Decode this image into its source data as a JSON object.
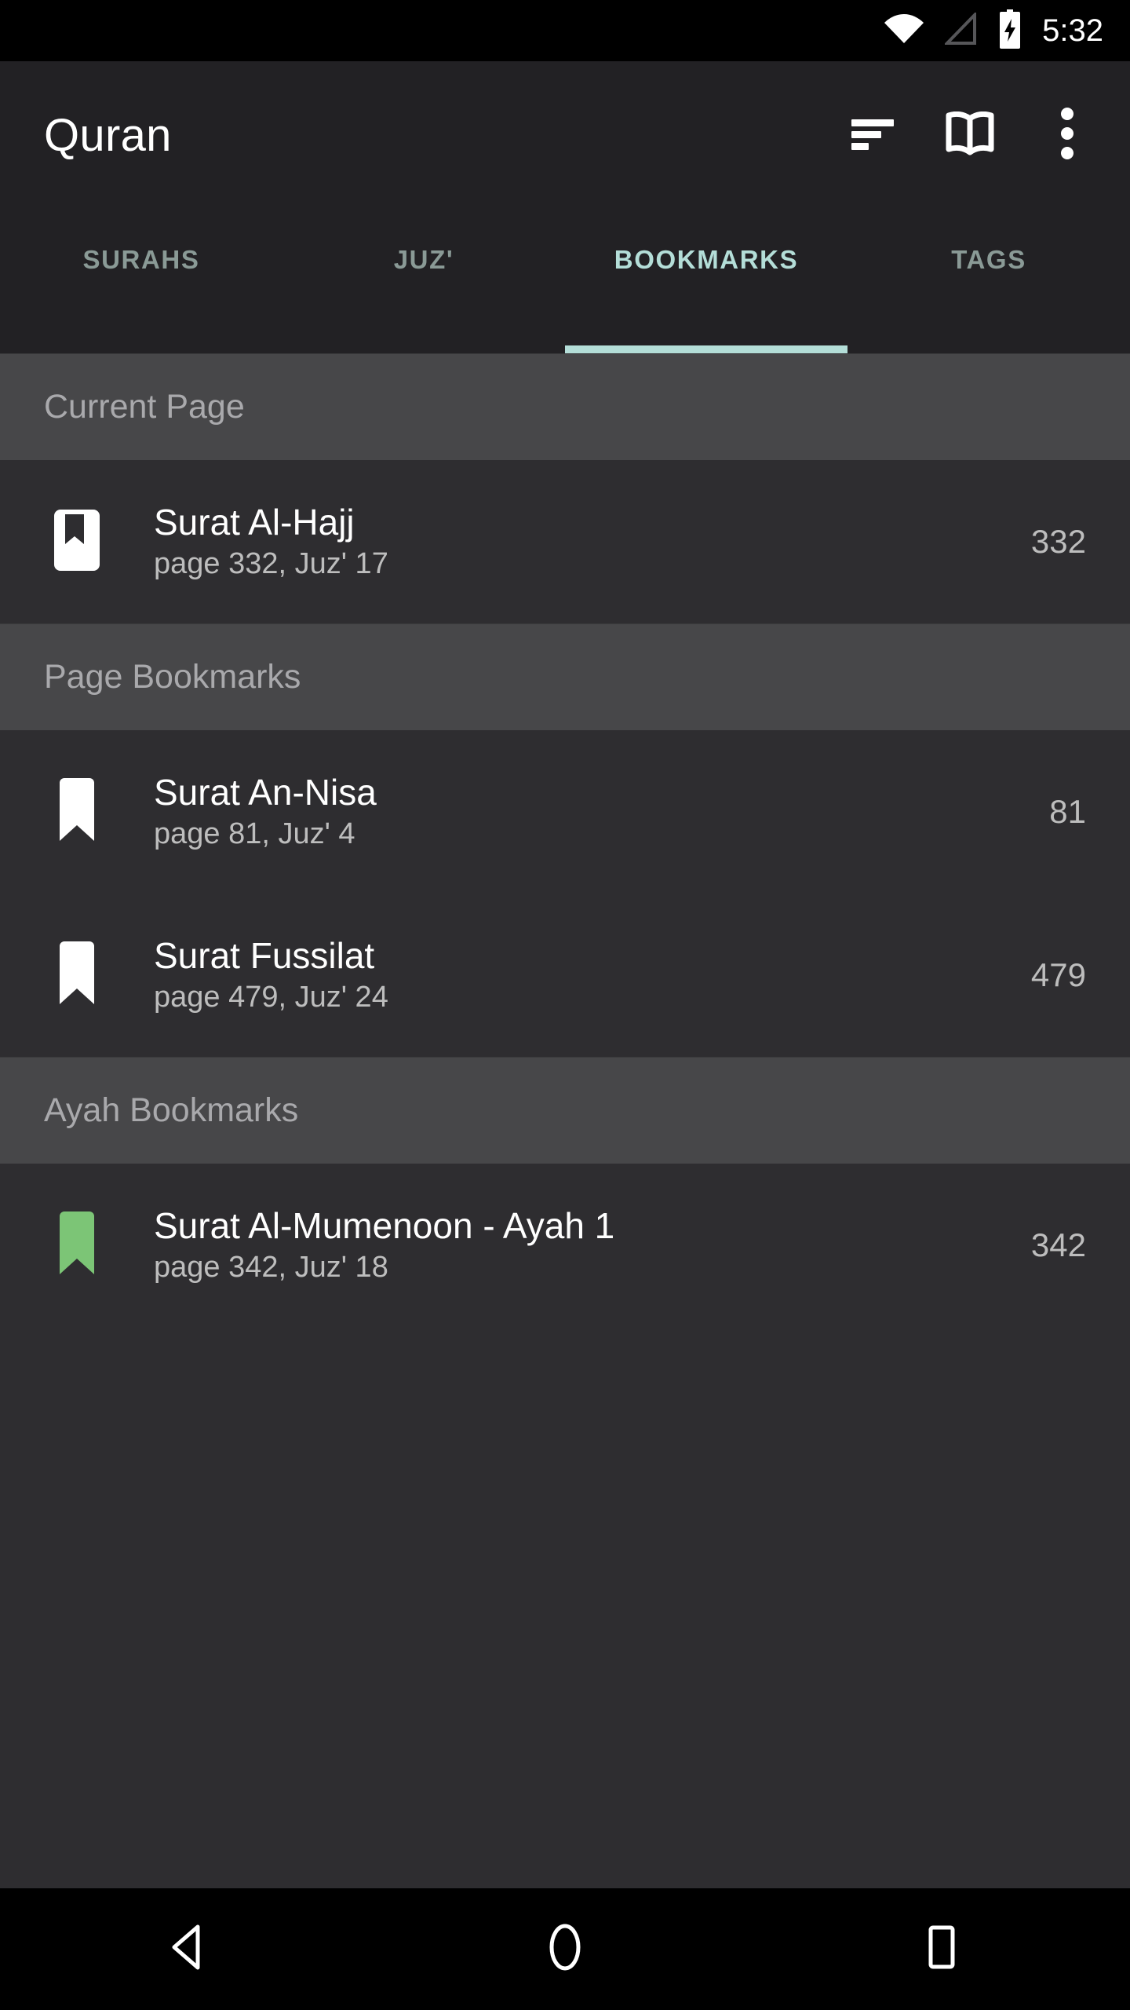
{
  "status_bar": {
    "time": "5:32",
    "icons": [
      "wifi-icon",
      "cellular-signal-icon",
      "battery-charging-icon"
    ]
  },
  "app_bar": {
    "title": "Quran",
    "actions": [
      {
        "name": "sort-icon",
        "label": "Sort"
      },
      {
        "name": "open-book-icon",
        "label": "Go to page"
      },
      {
        "name": "overflow-menu-icon",
        "label": "More options"
      }
    ]
  },
  "tabs": {
    "active_index": 2,
    "active_color": "#b4ded8",
    "inactive_color": "#8a9a96",
    "items": [
      {
        "label": "SURAHS"
      },
      {
        "label": "JUZ'"
      },
      {
        "label": "BOOKMARKS"
      },
      {
        "label": "TAGS"
      }
    ]
  },
  "list": {
    "sections": [
      {
        "header": "Current Page",
        "rows": [
          {
            "icon": "current-page-bookmark-icon",
            "icon_color": "#ffffff",
            "title": "Surat Al-Hajj",
            "subtitle": "page 332, Juz' 17",
            "value": "332"
          }
        ]
      },
      {
        "header": "Page Bookmarks",
        "rows": [
          {
            "icon": "bookmark-icon",
            "icon_color": "#ffffff",
            "title": "Surat An-Nisa",
            "subtitle": "page 81, Juz' 4",
            "value": "81"
          },
          {
            "icon": "bookmark-icon",
            "icon_color": "#ffffff",
            "title": "Surat Fussilat",
            "subtitle": "page 479, Juz' 24",
            "value": "479"
          }
        ]
      },
      {
        "header": "Ayah Bookmarks",
        "rows": [
          {
            "icon": "bookmark-icon",
            "icon_color": "#7cc576",
            "title": "Surat Al-Mumenoon - Ayah 1",
            "subtitle": "page 342, Juz' 18",
            "value": "342"
          }
        ]
      }
    ]
  },
  "nav_bar": {
    "buttons": [
      {
        "name": "back-icon",
        "label": "Back"
      },
      {
        "name": "home-icon",
        "label": "Home"
      },
      {
        "name": "recents-icon",
        "label": "Recents"
      }
    ]
  },
  "colors": {
    "window_background": "#2e2d30",
    "app_bar_background": "#222124",
    "section_header_background": "#474749",
    "accent": "#b4ded8",
    "ayah_bookmark_green": "#7cc576"
  }
}
